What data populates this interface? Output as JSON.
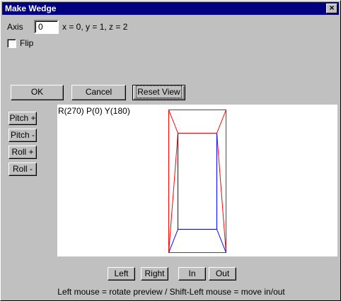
{
  "window": {
    "title": "Make Wedge",
    "close_glyph": "×"
  },
  "axis": {
    "label": "Axis",
    "value": "0",
    "hint": "x = 0, y = 1, z = 2"
  },
  "flip": {
    "label": "Flip",
    "checked": false
  },
  "buttons": {
    "ok": "OK",
    "cancel": "Cancel",
    "reset_view": "Reset View",
    "pitch_plus": "Pitch +",
    "pitch_minus": "Pitch -",
    "roll_plus": "Roll +",
    "roll_minus": "Roll -",
    "left": "Left",
    "right": "Right",
    "in": "In",
    "out": "Out"
  },
  "preview": {
    "readout": "R(270) P(0) Y(180)",
    "outline_color": "#ff0000",
    "inner_color": "#0000ff"
  },
  "footer": {
    "hint": "Left mouse = rotate preview  / Shift-Left mouse = move in/out"
  }
}
